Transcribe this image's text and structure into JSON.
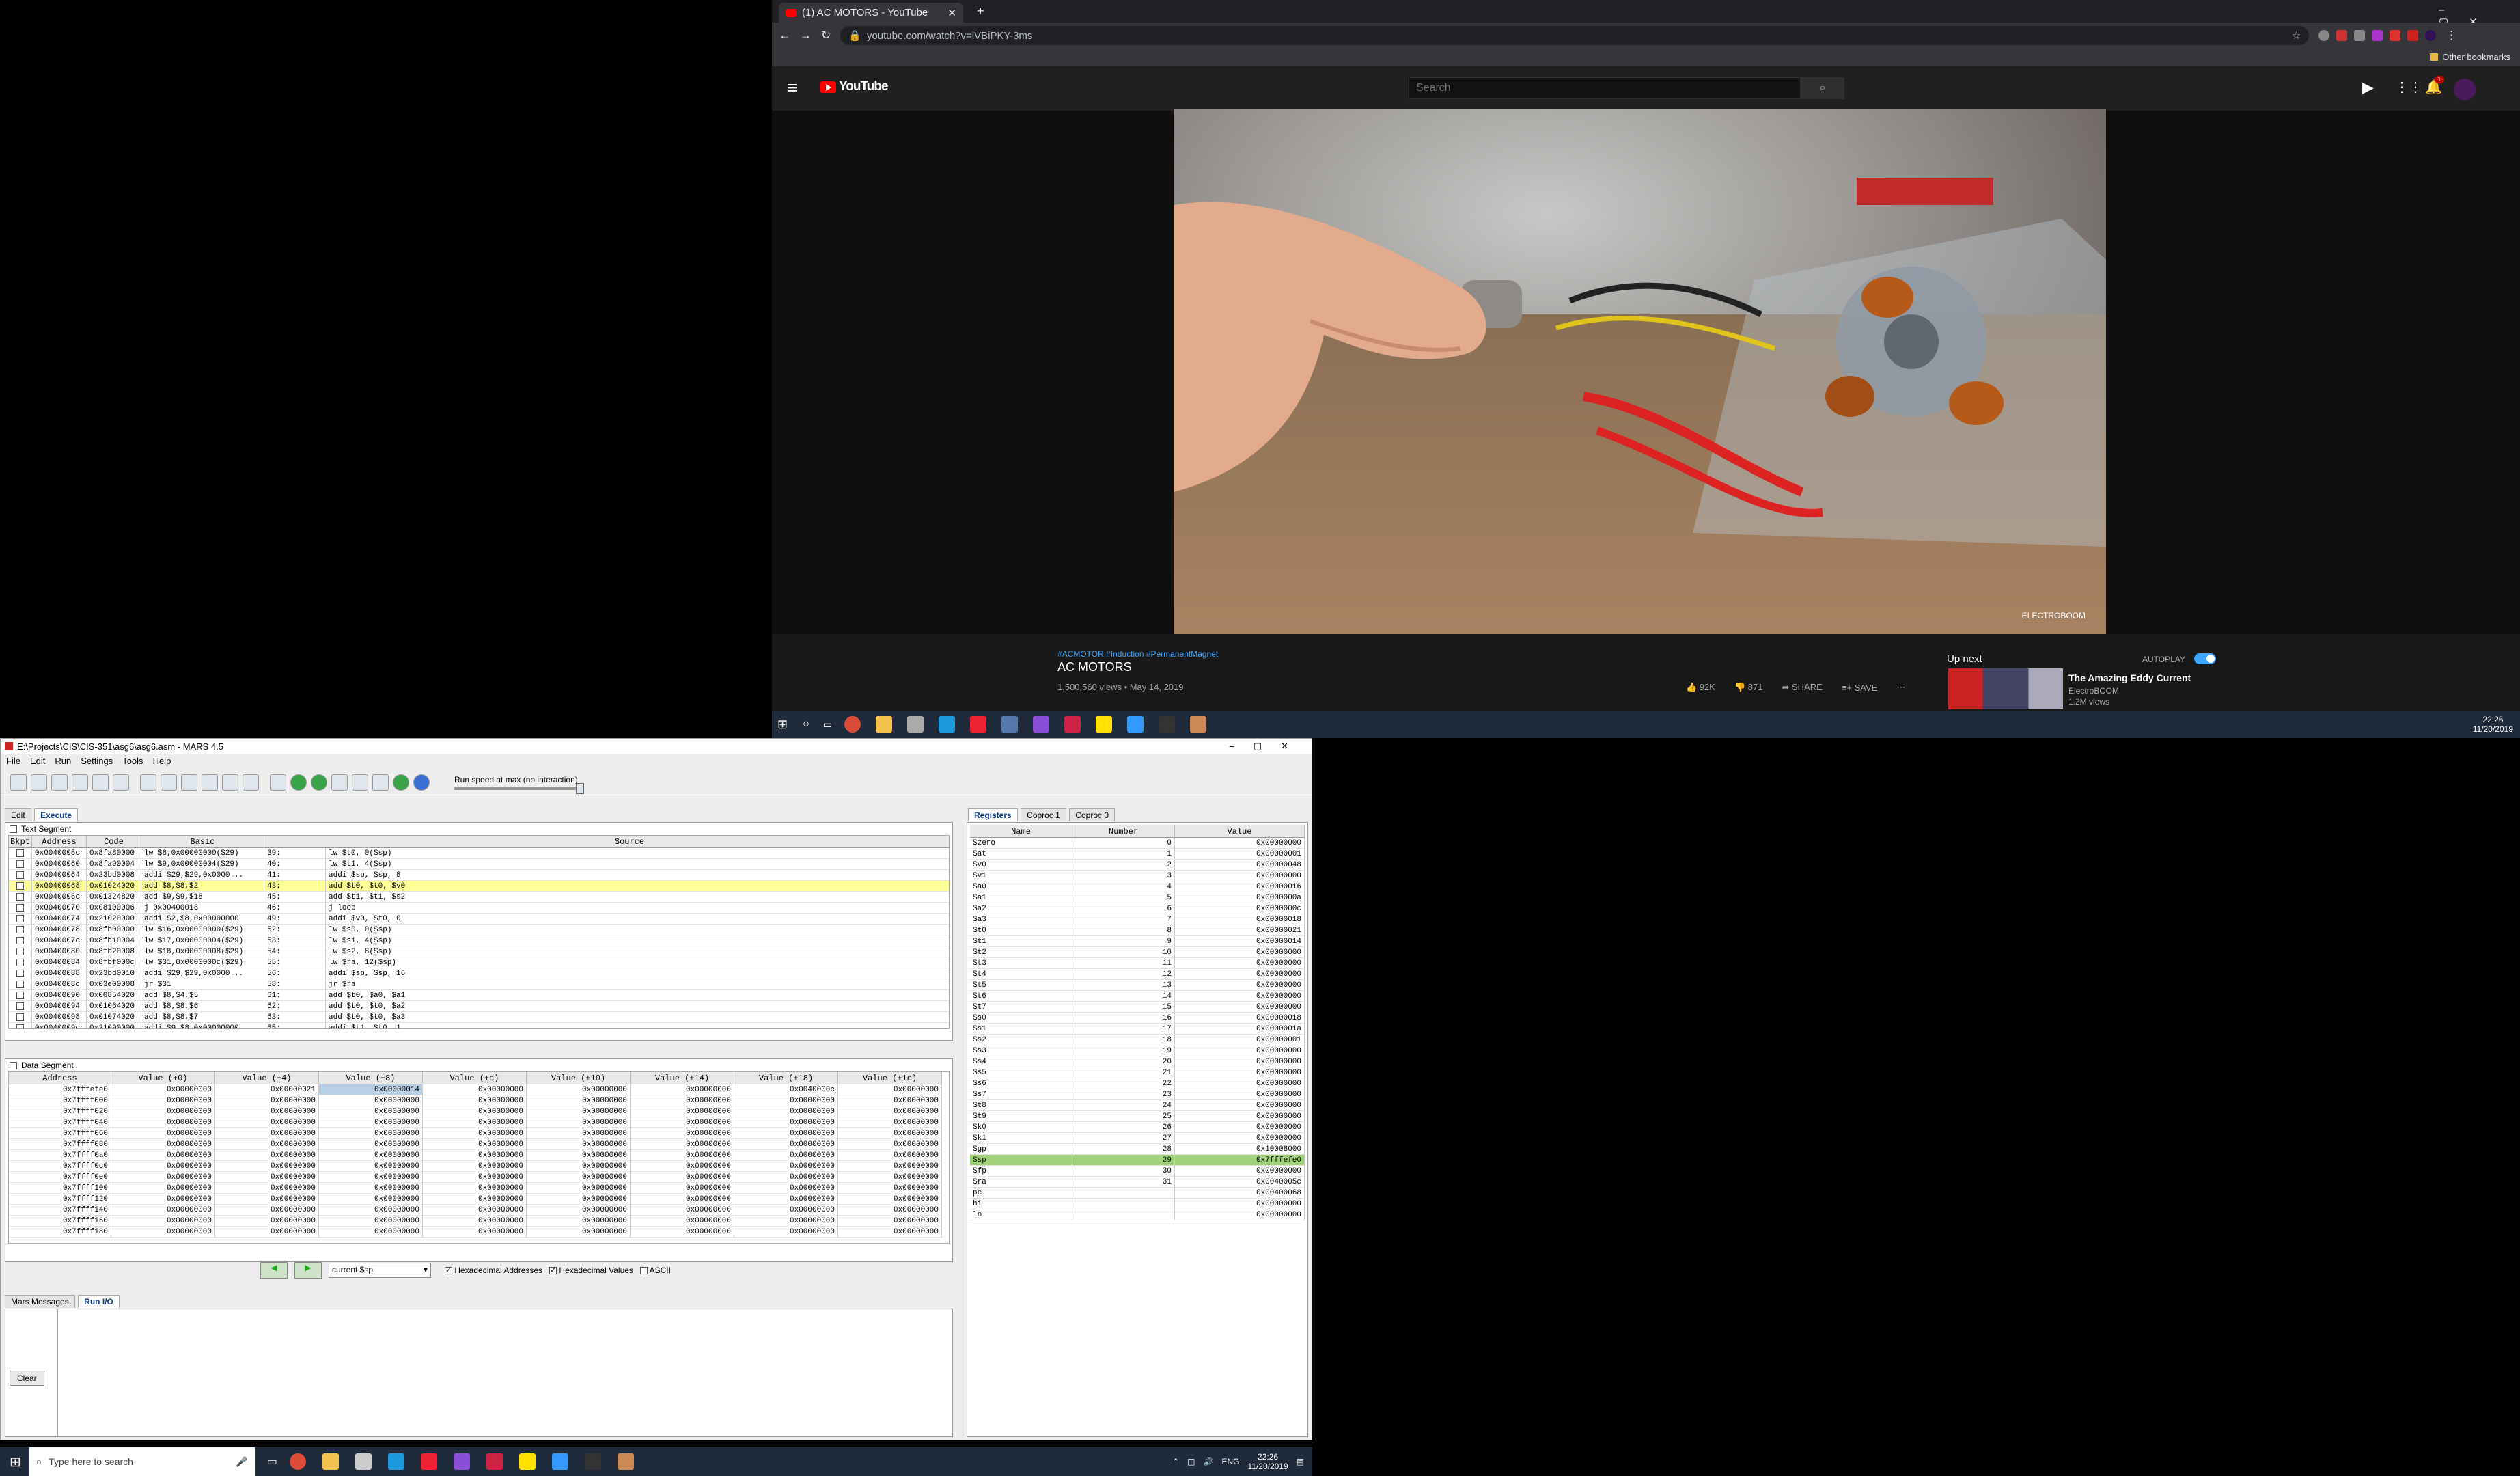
{
  "browser": {
    "tab_title": "(1) AC MOTORS - YouTube",
    "url": "youtube.com/watch?v=lVBiPKY-3ms",
    "other_bookmarks": "Other bookmarks"
  },
  "youtube": {
    "logo": "YouTube",
    "search_placeholder": "Search",
    "notifications": "1",
    "watermark": "ELECTROBOOM",
    "hashtags": "#ACMOTOR #Induction #PermanentMagnet",
    "video_title": "AC MOTORS",
    "meta": "1,500,560 views • May 14, 2019",
    "likes": "92K",
    "dislikes": "871",
    "share": "SHARE",
    "save": "SAVE",
    "up_next": "Up next",
    "autoplay": "AUTOPLAY",
    "next_title": "The Amazing Eddy Current",
    "next_channel": "ElectroBOOM",
    "next_views": "1.2M views"
  },
  "taskbar_top": {
    "time": "22:26",
    "date": "11/20/2019"
  },
  "taskbar_bottom": {
    "search_placeholder": "Type here to search",
    "lang": "ENG",
    "time": "22:26",
    "date": "11/20/2019"
  },
  "mars": {
    "title": "E:\\Projects\\CIS\\CIS-351\\asg6\\asg6.asm  - MARS 4.5",
    "menu": [
      "File",
      "Edit",
      "Run",
      "Settings",
      "Tools",
      "Help"
    ],
    "run_speed": "Run speed at max (no interaction)",
    "tabs": [
      "Edit",
      "Execute"
    ],
    "text_segment": {
      "title": "Text Segment",
      "headers": [
        "Bkpt",
        "Address",
        "Code",
        "Basic",
        "Source"
      ],
      "rows": [
        [
          "0x0040005c",
          "0x8fa80000",
          "lw $8,0x00000000($29)",
          "39:",
          "lw $t0, 0($sp)"
        ],
        [
          "0x00400060",
          "0x8fa90004",
          "lw $9,0x00000004($29)",
          "40:",
          "lw $t1, 4($sp)"
        ],
        [
          "0x00400064",
          "0x23bd0008",
          "addi $29,$29,0x0000...",
          "41:",
          "addi $sp, $sp, 8"
        ],
        [
          "0x00400068",
          "0x01024020",
          "add $8,$8,$2",
          "43:",
          "add $t0, $t0, $v0"
        ],
        [
          "0x0040006c",
          "0x01324820",
          "add $9,$9,$18",
          "45:",
          "add $t1, $t1, $s2"
        ],
        [
          "0x00400070",
          "0x08100006",
          "j 0x00400018",
          "46:",
          "j loop"
        ],
        [
          "0x00400074",
          "0x21020000",
          "addi $2,$8,0x00000000",
          "49:",
          "addi $v0, $t0, 0"
        ],
        [
          "0x00400078",
          "0x8fb00000",
          "lw $16,0x00000000($29)",
          "52:",
          "lw $s0, 0($sp)"
        ],
        [
          "0x0040007c",
          "0x8fb10004",
          "lw $17,0x00000004($29)",
          "53:",
          "lw $s1, 4($sp)"
        ],
        [
          "0x00400080",
          "0x8fb20008",
          "lw $18,0x00000008($29)",
          "54:",
          "lw $s2, 8($sp)"
        ],
        [
          "0x00400084",
          "0x8fbf000c",
          "lw $31,0x0000000c($29)",
          "55:",
          "lw $ra, 12($sp)"
        ],
        [
          "0x00400088",
          "0x23bd0010",
          "addi $29,$29,0x0000...",
          "56:",
          "addi $sp, $sp, 16"
        ],
        [
          "0x0040008c",
          "0x03e00008",
          "jr $31",
          "58:",
          "jr $ra"
        ],
        [
          "0x00400090",
          "0x00854020",
          "add $8,$4,$5",
          "61:",
          "add $t0, $a0, $a1"
        ],
        [
          "0x00400094",
          "0x01064020",
          "add $8,$8,$6",
          "62:",
          "add $t0, $t0, $a2"
        ],
        [
          "0x00400098",
          "0x01074020",
          "add $8,$8,$7",
          "63:",
          "add $t0, $t0, $a3"
        ],
        [
          "0x0040009c",
          "0x21090000",
          "addi $9,$8,0x00000000",
          "65:",
          "addi $t1, $t0, 1"
        ]
      ]
    },
    "data_segment": {
      "title": "Data Segment",
      "headers": [
        "Address",
        "Value (+0)",
        "Value (+4)",
        "Value (+8)",
        "Value (+c)",
        "Value (+10)",
        "Value (+14)",
        "Value (+18)",
        "Value (+1c)"
      ],
      "rows": [
        [
          "0x7fffefe0",
          "0x00000000",
          "0x00000021",
          "0x00000014",
          "0x00000000",
          "0x00000000",
          "0x00000000",
          "0x0040000c",
          "0x00000000"
        ],
        [
          "0x7ffff000",
          "0x00000000",
          "0x00000000",
          "0x00000000",
          "0x00000000",
          "0x00000000",
          "0x00000000",
          "0x00000000",
          "0x00000000"
        ],
        [
          "0x7ffff020",
          "0x00000000",
          "0x00000000",
          "0x00000000",
          "0x00000000",
          "0x00000000",
          "0x00000000",
          "0x00000000",
          "0x00000000"
        ],
        [
          "0x7ffff040",
          "0x00000000",
          "0x00000000",
          "0x00000000",
          "0x00000000",
          "0x00000000",
          "0x00000000",
          "0x00000000",
          "0x00000000"
        ],
        [
          "0x7ffff060",
          "0x00000000",
          "0x00000000",
          "0x00000000",
          "0x00000000",
          "0x00000000",
          "0x00000000",
          "0x00000000",
          "0x00000000"
        ],
        [
          "0x7ffff080",
          "0x00000000",
          "0x00000000",
          "0x00000000",
          "0x00000000",
          "0x00000000",
          "0x00000000",
          "0x00000000",
          "0x00000000"
        ],
        [
          "0x7ffff0a0",
          "0x00000000",
          "0x00000000",
          "0x00000000",
          "0x00000000",
          "0x00000000",
          "0x00000000",
          "0x00000000",
          "0x00000000"
        ],
        [
          "0x7ffff0c0",
          "0x00000000",
          "0x00000000",
          "0x00000000",
          "0x00000000",
          "0x00000000",
          "0x00000000",
          "0x00000000",
          "0x00000000"
        ],
        [
          "0x7ffff0e0",
          "0x00000000",
          "0x00000000",
          "0x00000000",
          "0x00000000",
          "0x00000000",
          "0x00000000",
          "0x00000000",
          "0x00000000"
        ],
        [
          "0x7ffff100",
          "0x00000000",
          "0x00000000",
          "0x00000000",
          "0x00000000",
          "0x00000000",
          "0x00000000",
          "0x00000000",
          "0x00000000"
        ],
        [
          "0x7ffff120",
          "0x00000000",
          "0x00000000",
          "0x00000000",
          "0x00000000",
          "0x00000000",
          "0x00000000",
          "0x00000000",
          "0x00000000"
        ],
        [
          "0x7ffff140",
          "0x00000000",
          "0x00000000",
          "0x00000000",
          "0x00000000",
          "0x00000000",
          "0x00000000",
          "0x00000000",
          "0x00000000"
        ],
        [
          "0x7ffff160",
          "0x00000000",
          "0x00000000",
          "0x00000000",
          "0x00000000",
          "0x00000000",
          "0x00000000",
          "0x00000000",
          "0x00000000"
        ],
        [
          "0x7ffff180",
          "0x00000000",
          "0x00000000",
          "0x00000000",
          "0x00000000",
          "0x00000000",
          "0x00000000",
          "0x00000000",
          "0x00000000"
        ]
      ],
      "nav_select": "current $sp",
      "hex_addresses": "Hexadecimal Addresses",
      "hex_values": "Hexadecimal Values",
      "ascii": "ASCII"
    },
    "registers": {
      "tabs": [
        "Registers",
        "Coproc 1",
        "Coproc 0"
      ],
      "headers": [
        "Name",
        "Number",
        "Value"
      ],
      "rows": [
        [
          "$zero",
          "0",
          "0x00000000"
        ],
        [
          "$at",
          "1",
          "0x00000001"
        ],
        [
          "$v0",
          "2",
          "0x00000048"
        ],
        [
          "$v1",
          "3",
          "0x00000000"
        ],
        [
          "$a0",
          "4",
          "0x00000016"
        ],
        [
          "$a1",
          "5",
          "0x0000000a"
        ],
        [
          "$a2",
          "6",
          "0x0000000c"
        ],
        [
          "$a3",
          "7",
          "0x00000018"
        ],
        [
          "$t0",
          "8",
          "0x00000021"
        ],
        [
          "$t1",
          "9",
          "0x00000014"
        ],
        [
          "$t2",
          "10",
          "0x00000000"
        ],
        [
          "$t3",
          "11",
          "0x00000000"
        ],
        [
          "$t4",
          "12",
          "0x00000000"
        ],
        [
          "$t5",
          "13",
          "0x00000000"
        ],
        [
          "$t6",
          "14",
          "0x00000000"
        ],
        [
          "$t7",
          "15",
          "0x00000000"
        ],
        [
          "$s0",
          "16",
          "0x00000018"
        ],
        [
          "$s1",
          "17",
          "0x0000001a"
        ],
        [
          "$s2",
          "18",
          "0x00000001"
        ],
        [
          "$s3",
          "19",
          "0x00000000"
        ],
        [
          "$s4",
          "20",
          "0x00000000"
        ],
        [
          "$s5",
          "21",
          "0x00000000"
        ],
        [
          "$s6",
          "22",
          "0x00000000"
        ],
        [
          "$s7",
          "23",
          "0x00000000"
        ],
        [
          "$t8",
          "24",
          "0x00000000"
        ],
        [
          "$t9",
          "25",
          "0x00000000"
        ],
        [
          "$k0",
          "26",
          "0x00000000"
        ],
        [
          "$k1",
          "27",
          "0x00000000"
        ],
        [
          "$gp",
          "28",
          "0x10008000"
        ],
        [
          "$sp",
          "29",
          "0x7fffefe0"
        ],
        [
          "$fp",
          "30",
          "0x00000000"
        ],
        [
          "$ra",
          "31",
          "0x0040005c"
        ],
        [
          "pc",
          "",
          "0x00400068"
        ],
        [
          "hi",
          "",
          "0x00000000"
        ],
        [
          "lo",
          "",
          "0x00000000"
        ]
      ]
    },
    "messages": {
      "tabs": [
        "Mars Messages",
        "Run I/O"
      ],
      "clear": "Clear"
    }
  }
}
